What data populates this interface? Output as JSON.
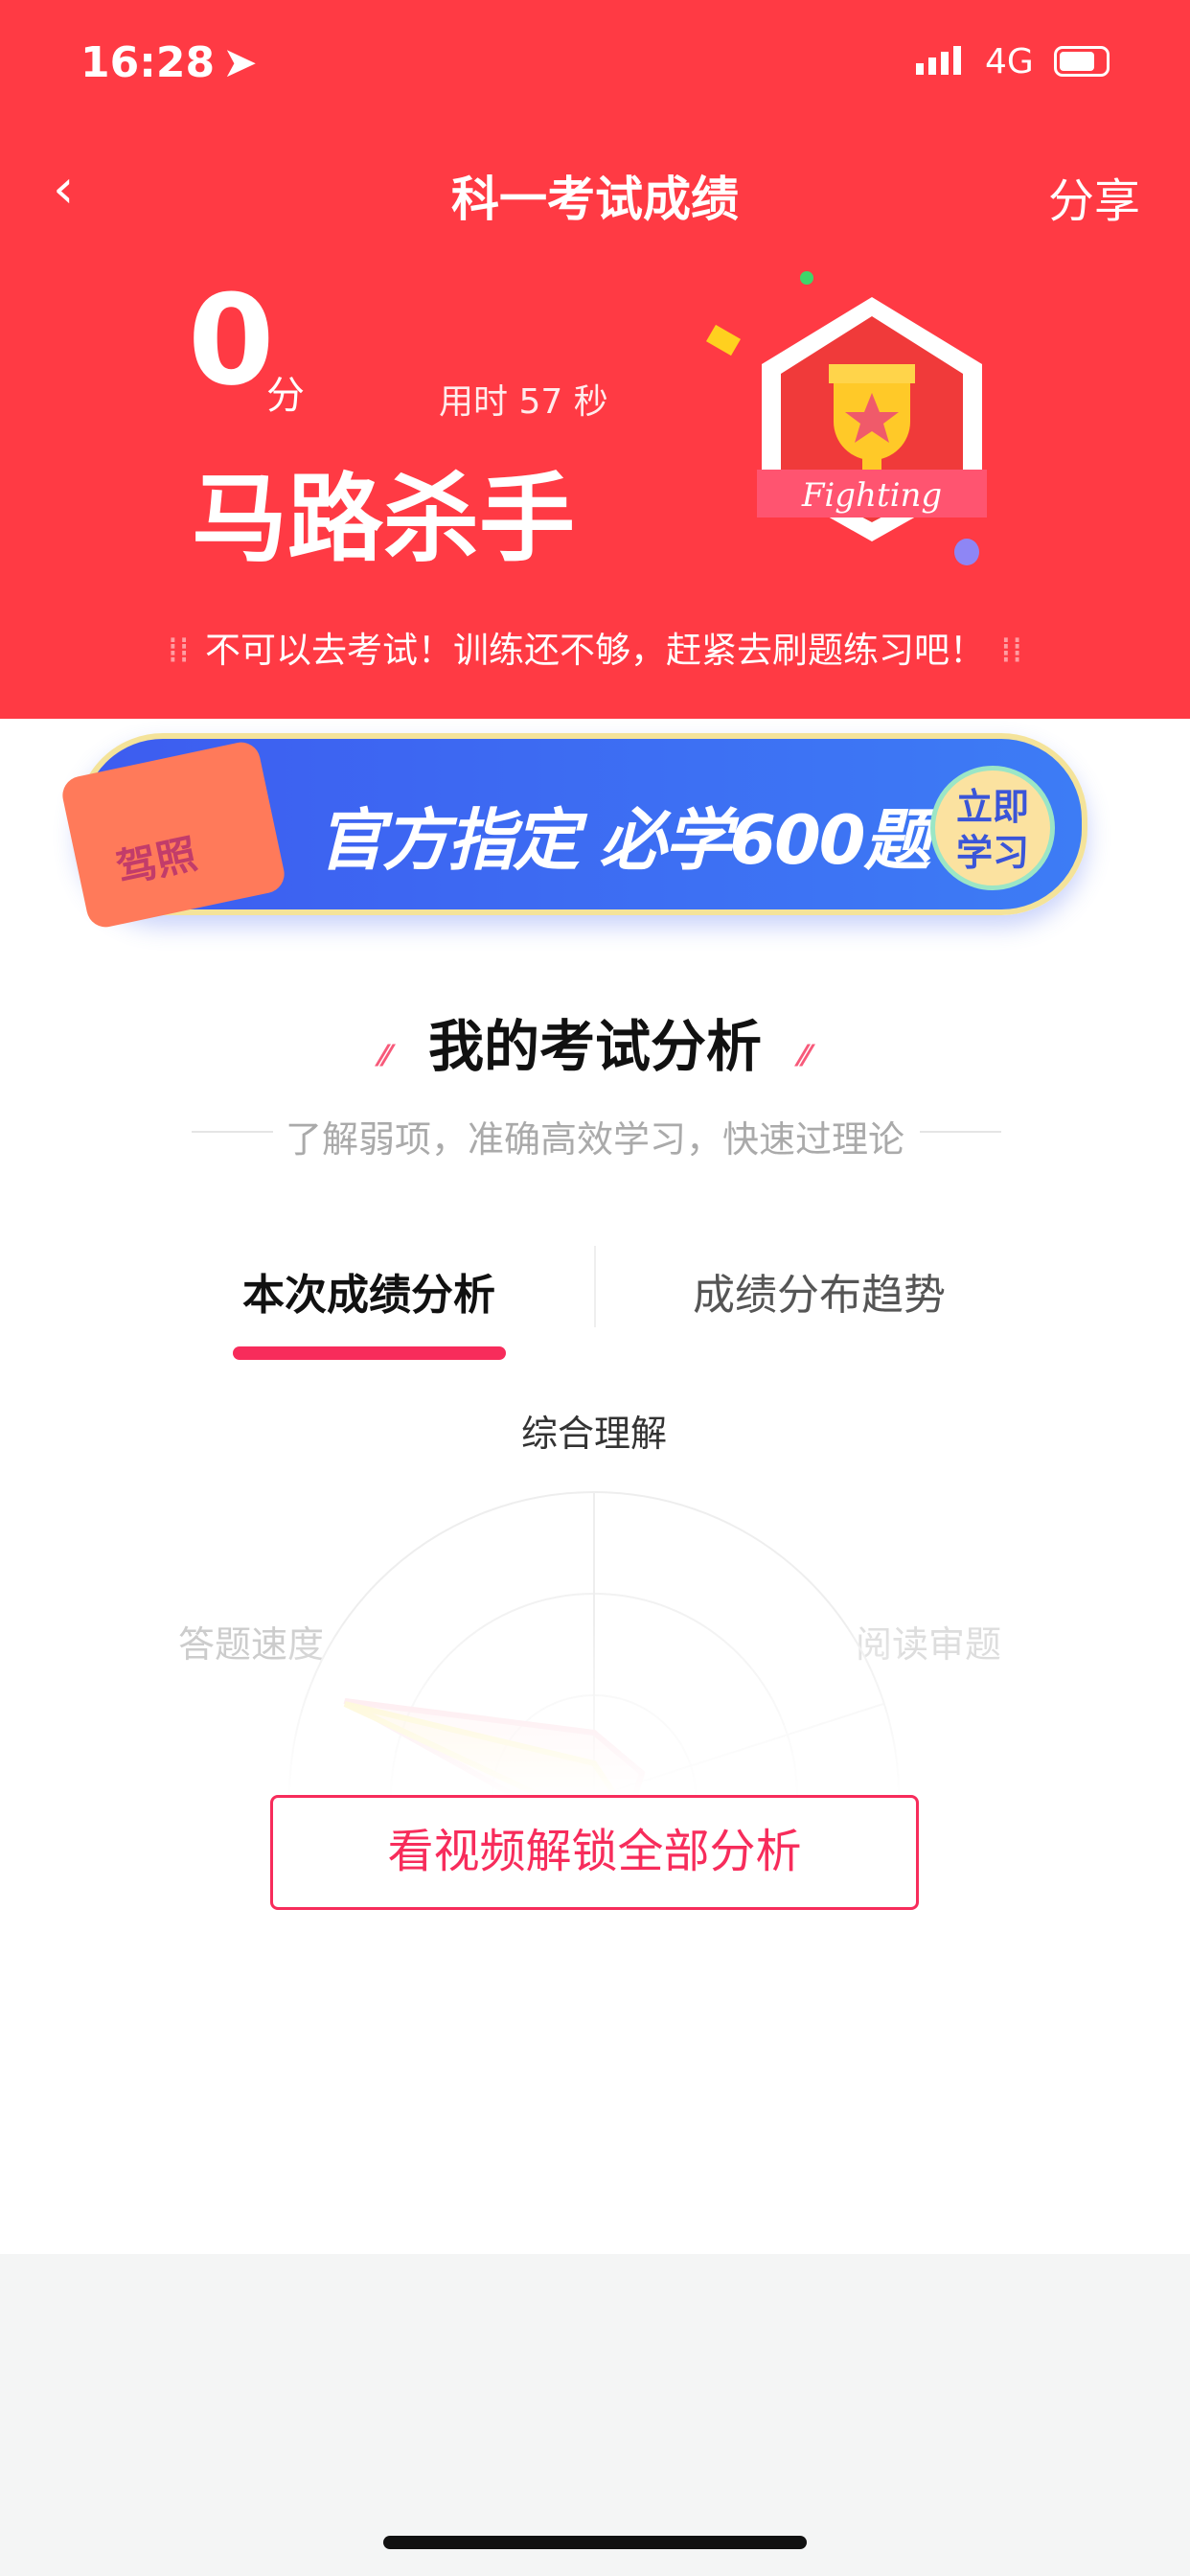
{
  "status_bar": {
    "time": "16:28",
    "network": "4G"
  },
  "nav": {
    "title": "科一考试成绩",
    "share": "分享"
  },
  "result": {
    "score": "0",
    "score_unit": "分",
    "time_used": "用时 57 秒",
    "rank_title": "马路杀手",
    "badge_text": "Fighting",
    "message": "不可以去考试！训练还不够，赶紧去刷题练习吧！"
  },
  "banner": {
    "license_tag": "驾照",
    "headline": "官方指定 必学600题",
    "cta": "立即学习"
  },
  "analysis": {
    "title": "我的考试分析",
    "subtitle": "了解弱项，准确高效学习，快速过理论",
    "tabs": [
      {
        "label": "本次成绩分析",
        "active": true
      },
      {
        "label": "成绩分布趋势",
        "active": false
      }
    ],
    "radar_labels": {
      "top": "综合理解",
      "left": "答题速度",
      "right": "阅读审题"
    },
    "unlock_button": "看视频解锁全部分析"
  },
  "colors": {
    "header_red": "#ff3a44",
    "accent_pink": "#f72c5b",
    "banner_blue": "#3f6cf0"
  }
}
